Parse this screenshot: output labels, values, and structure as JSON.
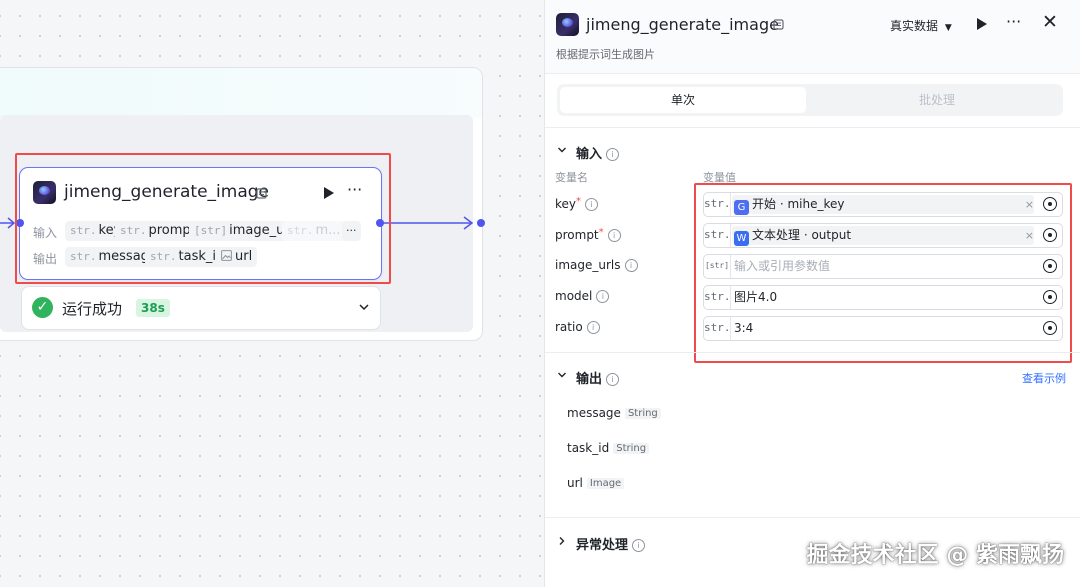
{
  "node": {
    "title": "jimeng_generate_image",
    "input_label": "输入",
    "output_label": "输出",
    "inputs": [
      {
        "type": "str.",
        "name": "key"
      },
      {
        "type": "str.",
        "name": "prompt"
      },
      {
        "type": "[str]",
        "name": "image_urls"
      },
      {
        "type": "str.",
        "name": "m..."
      }
    ],
    "outputs": [
      {
        "type": "str.",
        "name": "message"
      },
      {
        "type": "str.",
        "name": "task_id"
      },
      {
        "type": "img",
        "name": "url"
      }
    ],
    "more": "···",
    "status": {
      "text": "运行成功",
      "time": "38s"
    }
  },
  "panel": {
    "title": "jimeng_generate_image",
    "subtitle": "根据提示词生成图片",
    "data_mode": "真实数据",
    "tabs": [
      {
        "label": "单次"
      },
      {
        "label": "批处理"
      }
    ],
    "input_section": {
      "title": "输入",
      "col_name": "变量名",
      "col_value": "变量值",
      "rows": [
        {
          "name": "key",
          "required": true,
          "type": "str.",
          "kind": "ref",
          "ref_icon": "G",
          "ref_text": "开始 · mihe_key"
        },
        {
          "name": "prompt",
          "required": true,
          "type": "str.",
          "kind": "ref",
          "ref_icon": "W",
          "ref_text": "文本处理 · output"
        },
        {
          "name": "image_urls",
          "required": false,
          "type": "[str]",
          "kind": "placeholder",
          "placeholder": "输入或引用参数值"
        },
        {
          "name": "model",
          "required": false,
          "type": "str.",
          "kind": "text",
          "value": "图片4.0"
        },
        {
          "name": "ratio",
          "required": false,
          "type": "str.",
          "kind": "text",
          "value": "3:4"
        }
      ]
    },
    "output_section": {
      "title": "输出",
      "example_link": "查看示例",
      "rows": [
        {
          "name": "message",
          "type": "String"
        },
        {
          "name": "task_id",
          "type": "String"
        },
        {
          "name": "url",
          "type": "Image"
        }
      ]
    },
    "error_section": {
      "title": "异常处理"
    }
  },
  "watermark": "掘金技术社区 @ 紫雨飘扬",
  "colors": {
    "accent": "#4e55f0",
    "highlight": "#f04a4a",
    "success": "#2fb35c"
  }
}
